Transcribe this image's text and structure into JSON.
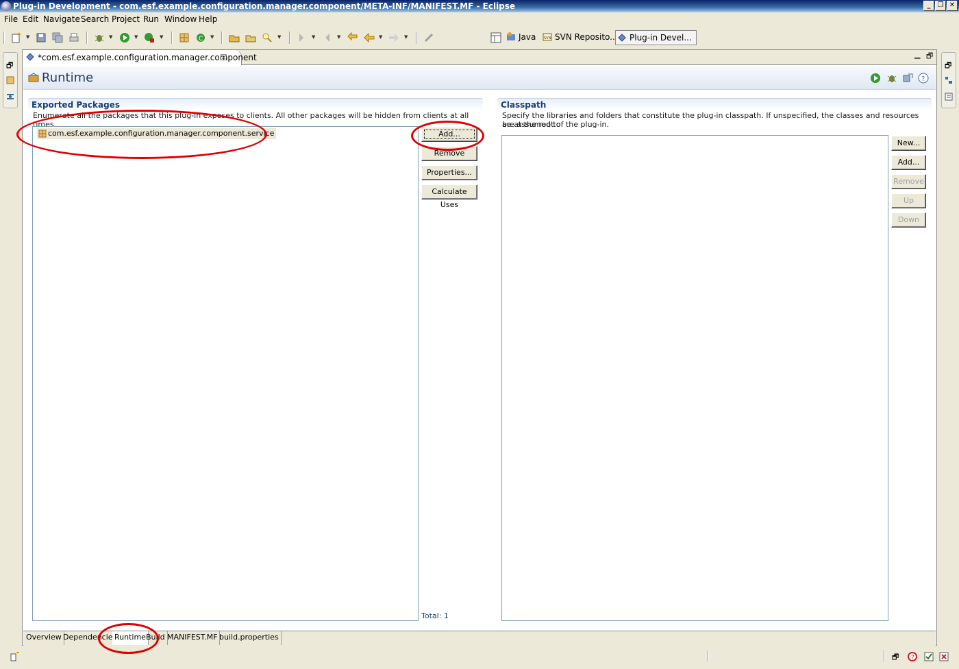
{
  "window": {
    "title": "Plug-in Development - com.esf.example.configuration.manager.component/META-INF/MANIFEST.MF - Eclipse"
  },
  "menu": [
    "File",
    "Edit",
    "Navigate",
    "Search",
    "Project",
    "Run",
    "Window",
    "Help"
  ],
  "perspectives": [
    {
      "label": "Java",
      "active": false
    },
    {
      "label": "SVN Reposito...",
      "active": false
    },
    {
      "label": "Plug-in Devel...",
      "active": true
    }
  ],
  "editor": {
    "tab_label": "*com.esf.example.configuration.manager.component",
    "form_title": "Runtime"
  },
  "exported_packages": {
    "title": "Exported Packages",
    "description": "Enumerate all the packages that this plug-in exposes to clients.  All other packages will be hidden from clients at all times.",
    "items": [
      "com.esf.example.configuration.manager.component.service"
    ],
    "buttons": {
      "add": "Add...",
      "remove": "Remove",
      "properties": "Properties...",
      "calculate_uses": "Calculate Uses"
    },
    "total": "Total: 1"
  },
  "classpath": {
    "title": "Classpath",
    "description_line1": "Specify the libraries and folders that constitute the plug-in classpath.  If unspecified, the classes and resources are assumed to",
    "description_line2": "be at the root of the plug-in.",
    "buttons": {
      "new": "New...",
      "add": "Add...",
      "remove": "Remove",
      "up": "Up",
      "down": "Down"
    }
  },
  "page_tabs": [
    {
      "label": "Overview",
      "active": false
    },
    {
      "label": "Dependencies",
      "active": false
    },
    {
      "label": "Runtime",
      "active": true
    },
    {
      "label": "Build",
      "active": false
    },
    {
      "label": "MANIFEST.MF",
      "active": false
    },
    {
      "label": "build.properties",
      "active": false
    }
  ],
  "colors": {
    "annotation": "#e00000",
    "section_title": "#1a3e72",
    "title_bar": "#0a246a"
  }
}
